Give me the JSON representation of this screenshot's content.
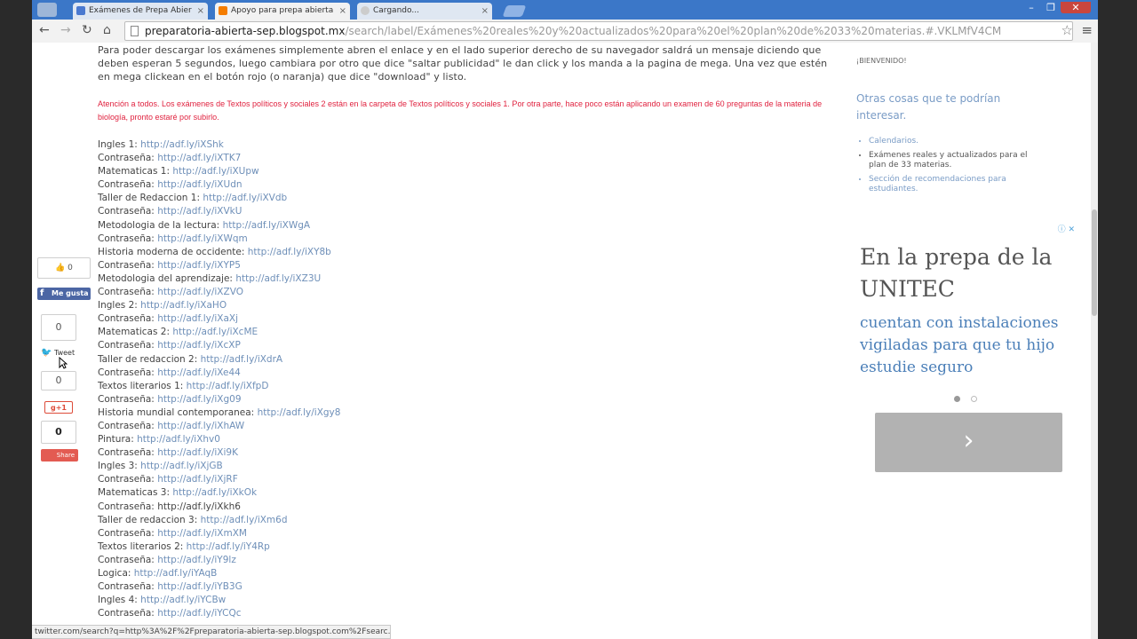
{
  "browser": {
    "tabs": [
      {
        "label": "Exámenes de Prepa Abier",
        "favicon_color": "#4a79d0"
      },
      {
        "label": "Apoyo para prepa abierta",
        "favicon_color": "#f57d00",
        "active": true
      },
      {
        "label": "Cargando...",
        "favicon_color": "#cccccc"
      }
    ],
    "url_host": "preparatoria-abierta-sep.blogspot.mx",
    "url_path": "/search/label/Exámenes%20reales%20y%20actualizados%20para%20el%20plan%20de%2033%20materias.#.VKLMfV4CM",
    "status_url": "twitter.com/search?q=http%3A%2F%2Fpreparatoria-abierta-sep.blogspot.com%2Fsearc..."
  },
  "post": {
    "intro": "Para poder descargar los exámenes simplemente abren el enlace y en el lado superior derecho de su navegador saldrá un mensaje diciendo que deben esperan 5 segundos, luego cambiara por otro que dice \"saltar publicidad\" le dan click y los manda a la pagina de mega. Una vez que estén en mega clickean en el botón rojo (o naranja) que dice \"download\" y listo.",
    "notice": "Atención a todos. Los exámenes de Textos políticos y sociales 2 están en la carpeta de Textos políticos y sociales 1. Por otra parte, hace poco están aplicando un examen de 60 preguntas de la materia de biología, pronto estaré por subirlo.",
    "links": [
      {
        "label": "Ingles 1:",
        "url": "http://adf.ly/iXShk"
      },
      {
        "label": "Contraseña:",
        "url": "http://adf.ly/iXTK7"
      },
      {
        "label": "Matematicas 1:",
        "url": "http://adf.ly/iXUpw"
      },
      {
        "label": "Contraseña:",
        "url": "http://adf.ly/iXUdn"
      },
      {
        "label": "Taller de Redaccion 1:",
        "url": "http://adf.ly/iXVdb"
      },
      {
        "label": "Contraseña:",
        "url": "http://adf.ly/iXVkU"
      },
      {
        "label": "Metodologia de la lectura:",
        "url": "http://adf.ly/iXWgA"
      },
      {
        "label": "Contraseña:",
        "url": "http://adf.ly/iXWqm"
      },
      {
        "label": "Historia moderna de occidente:",
        "url": "http://adf.ly/iXY8b"
      },
      {
        "label": "Contraseña:",
        "url": "http://adf.ly/iXYP5"
      },
      {
        "label": "Metodologia del aprendizaje:",
        "url": "http://adf.ly/iXZ3U"
      },
      {
        "label": "Contraseña:",
        "url": "http://adf.ly/iXZVO"
      },
      {
        "label": "Ingles 2:",
        "url": "http://adf.ly/iXaHO"
      },
      {
        "label": "Contraseña:",
        "url": "http://adf.ly/iXaXj"
      },
      {
        "label": "Matematicas 2:",
        "url": "http://adf.ly/iXcME"
      },
      {
        "label": "Contraseña:",
        "url": "http://adf.ly/iXcXP"
      },
      {
        "label": "Taller de redaccion 2:",
        "url": "http://adf.ly/iXdrA"
      },
      {
        "label": "Contraseña:",
        "url": "http://adf.ly/iXe44"
      },
      {
        "label": "Textos literarios 1:",
        "url": "http://adf.ly/iXfpD"
      },
      {
        "label": "Contraseña:",
        "url": "http://adf.ly/iXg09"
      },
      {
        "label": "Historia mundial contemporanea:",
        "url": "http://adf.ly/iXgy8"
      },
      {
        "label": "Contraseña:",
        "url": "http://adf.ly/iXhAW"
      },
      {
        "label": "Pintura:",
        "url": "http://adf.ly/iXhv0"
      },
      {
        "label": "Contraseña:",
        "url": "http://adf.ly/iXi9K"
      },
      {
        "label": "Ingles 3:",
        "url": "http://adf.ly/iXjGB"
      },
      {
        "label": "Contraseña:",
        "url": "http://adf.ly/iXjRF"
      },
      {
        "label": "Matematicas 3:",
        "url": "http://adf.ly/iXkOk"
      },
      {
        "label": "Contraseña:",
        "url": "http://adf.ly/iXkh6",
        "plain": true
      },
      {
        "label": "Taller de redaccion 3:",
        "url": "http://adf.ly/iXm6d"
      },
      {
        "label": "Contraseña:",
        "url": "http://adf.ly/iXmXM"
      },
      {
        "label": "Textos literarios 2:",
        "url": "http://adf.ly/iY4Rp"
      },
      {
        "label": "Contraseña:",
        "url": "http://adf.ly/iY9lz"
      },
      {
        "label": "Logica:",
        "url": "http://adf.ly/iYAqB"
      },
      {
        "label": "Contraseña:",
        "url": "http://adf.ly/iYB3G"
      },
      {
        "label": "Ingles 4:",
        "url": "http://adf.ly/iYCBw"
      },
      {
        "label": "Contraseña:",
        "url": "http://adf.ly/iYCQc"
      }
    ]
  },
  "sidebar": {
    "welcome": "¡BIENVENIDO!",
    "others_title": "Otras cosas que te podrían interesar.",
    "others_items": [
      {
        "text": "Calendarios.",
        "dark": false
      },
      {
        "text": "Exámenes reales y actualizados para el plan de 33 materias.",
        "dark": true
      },
      {
        "text": "Sección de recomendaciones para estudiantes.",
        "dark": false
      }
    ],
    "ad": {
      "headline": "En la prepa de la UNITEC",
      "body": "cuentan con instalaciones vigiladas para que tu hijo estudie seguro",
      "next_arrow": "›"
    }
  },
  "share": {
    "fb_count": "0",
    "fb_label": "Me gusta",
    "tw_count": "0",
    "tw_label": "Tweet",
    "g_count": "0",
    "g_label": "g+1",
    "share_count": "0",
    "share_label": "Share"
  }
}
